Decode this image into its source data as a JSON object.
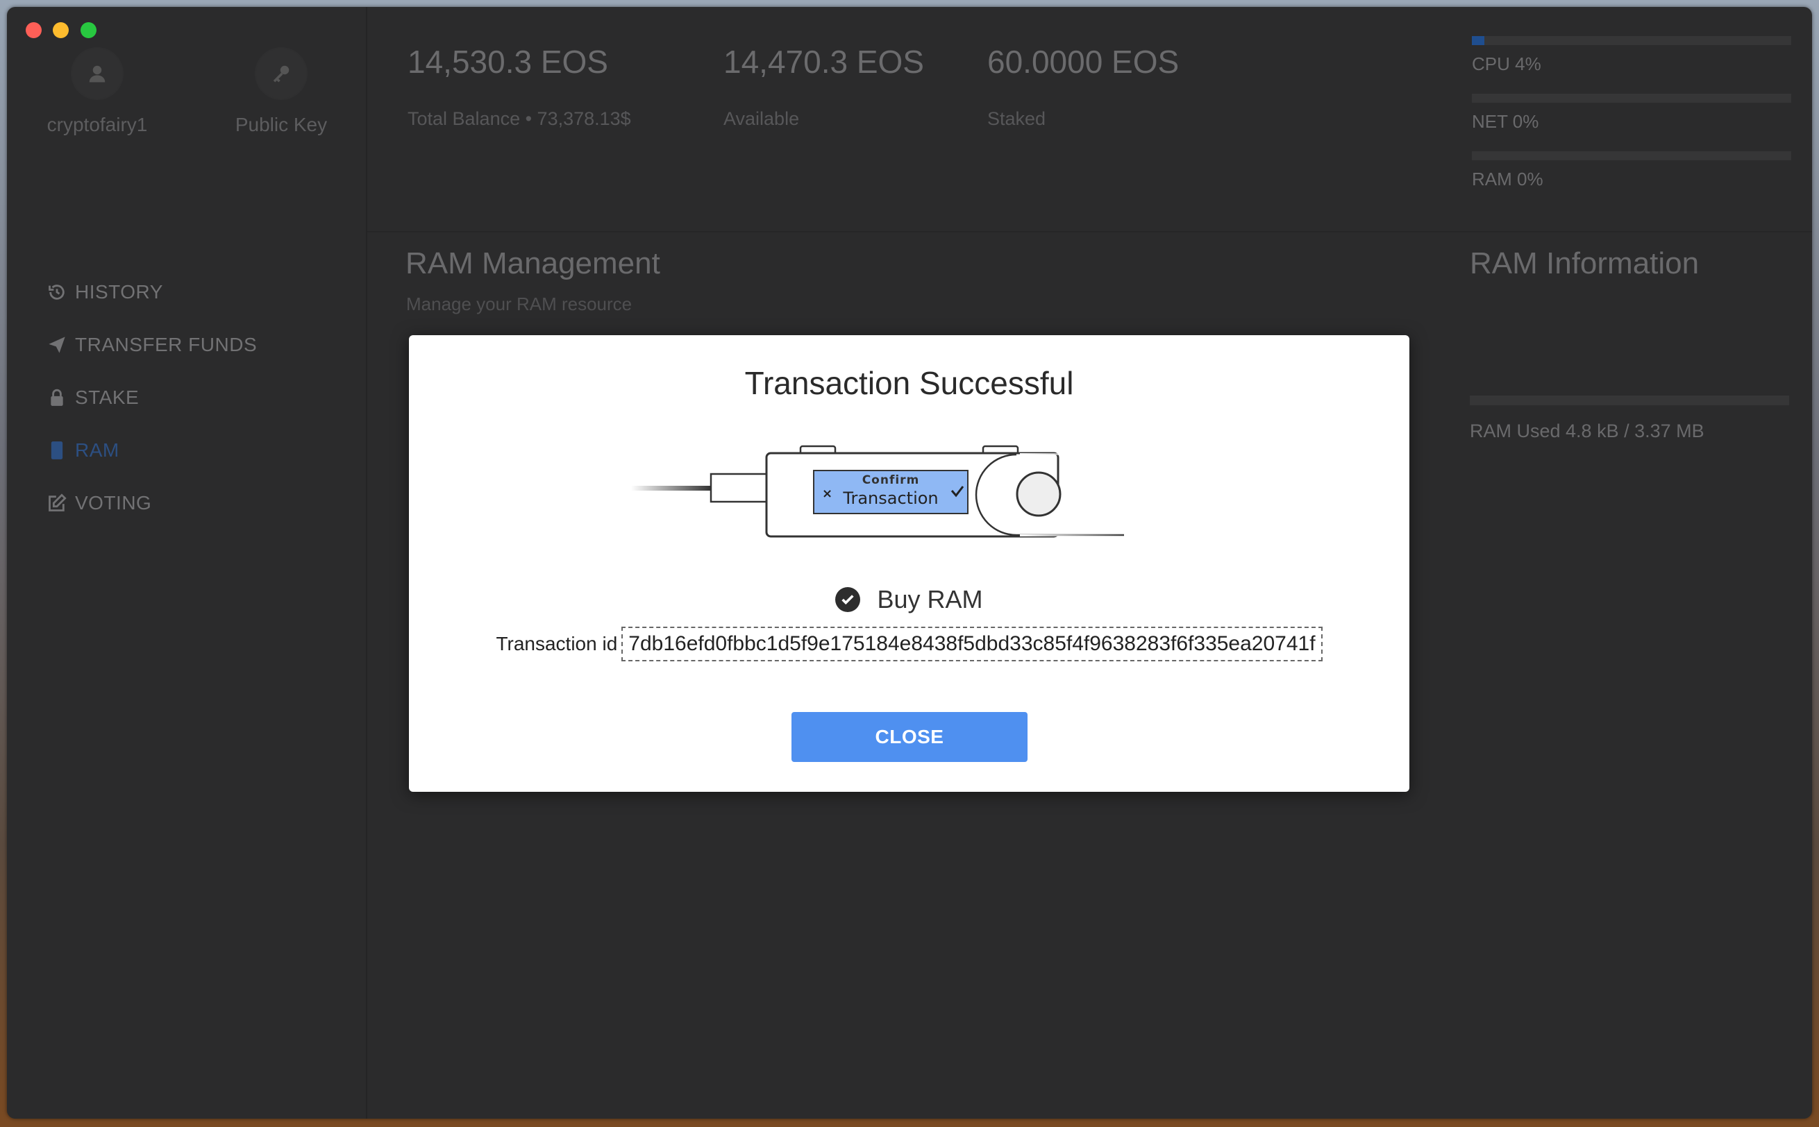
{
  "account": {
    "username": "cryptofairy1",
    "public_key_label": "Public Key"
  },
  "nav": {
    "history": "HISTORY",
    "transfer": "TRANSFER FUNDS",
    "stake": "STAKE",
    "ram": "RAM",
    "voting": "VOTING"
  },
  "balances": {
    "total": "14,530.3 EOS",
    "total_label": "Total Balance • 73,378.13$",
    "available": "14,470.3 EOS",
    "available_label": "Available",
    "staked": "60.0000 EOS",
    "staked_label": "Staked"
  },
  "resources": {
    "cpu_label": "CPU 4%",
    "cpu_percent": 4,
    "net_label": "NET 0%",
    "net_percent": 0,
    "ram_label": "RAM 0%",
    "ram_percent": 0
  },
  "ram_section": {
    "title": "RAM Management",
    "subtitle": "Manage your RAM resource",
    "info_title": "RAM Information",
    "used_label": "RAM Used 4.8 kB / 3.37 MB"
  },
  "modal": {
    "title": "Transaction Successful",
    "device_line1": "Confirm",
    "device_line2": "Transaction",
    "action": "Buy RAM",
    "tx_label": "Transaction id",
    "tx_id": "7db16efd0fbbc1d5f9e175184e8438f5dbd33c85f4f9638283f6f335ea20741f",
    "close": "CLOSE"
  },
  "colors": {
    "accent": "#4f90f0",
    "nav_active": "#2c4f82",
    "window_bg": "#2b2b2c"
  }
}
